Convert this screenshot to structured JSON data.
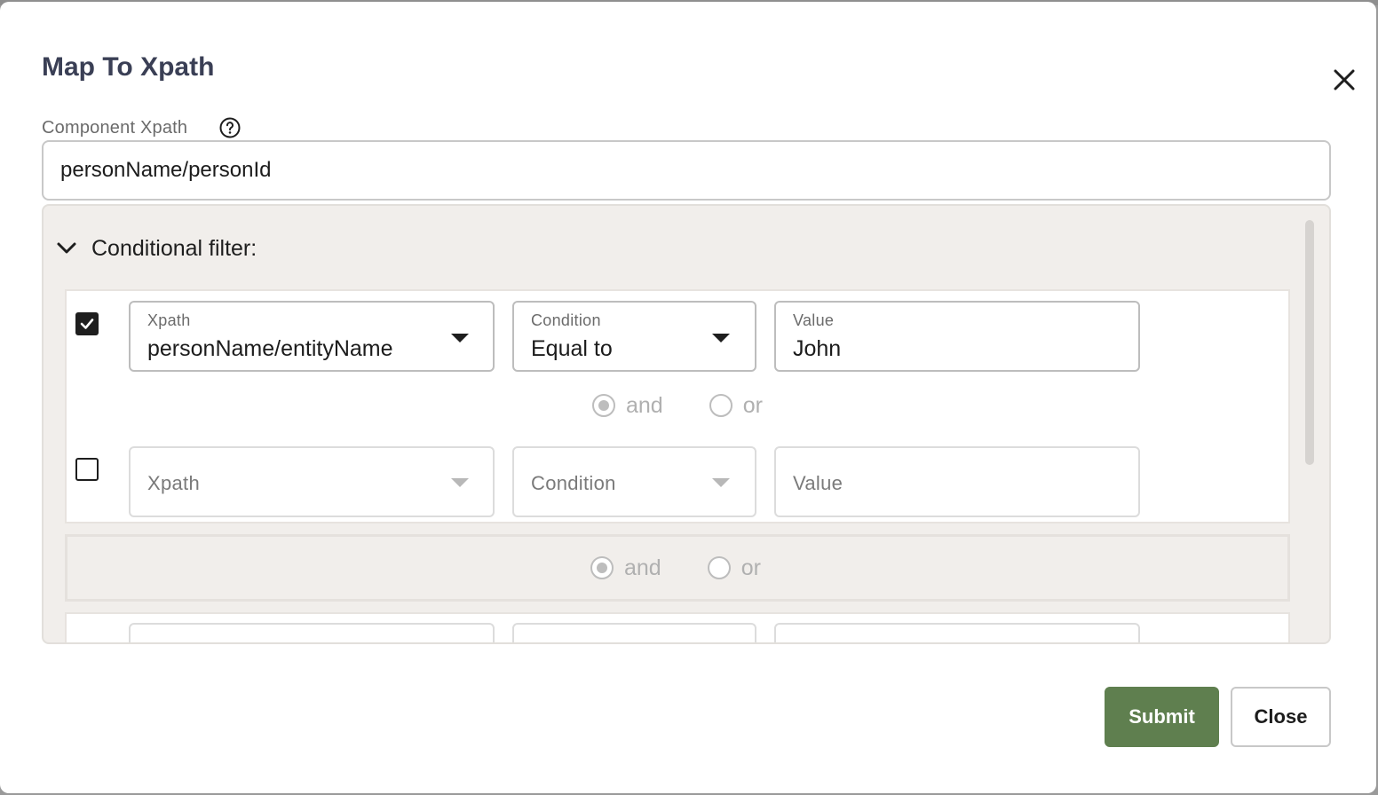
{
  "dialog": {
    "title": "Map To Xpath",
    "close_icon": "close-icon"
  },
  "component_xpath": {
    "label": "Component Xpath",
    "help_icon": "help-circle-icon",
    "value": "personName/personId"
  },
  "conditional_filter": {
    "header": "Conditional filter:",
    "toggle_icon": "chevron-down-icon",
    "rules": [
      {
        "checked": true,
        "xpath": {
          "label": "Xpath",
          "value": "personName/entityName"
        },
        "condition": {
          "label": "Condition",
          "value": "Equal to"
        },
        "value": {
          "label": "Value",
          "value": "John"
        }
      },
      {
        "checked": false,
        "xpath": {
          "placeholder": "Xpath"
        },
        "condition": {
          "placeholder": "Condition"
        },
        "value": {
          "placeholder": "Value"
        }
      }
    ],
    "inner_logic": {
      "and_label": "and",
      "or_label": "or",
      "selected": "and"
    },
    "group_logic": {
      "and_label": "and",
      "or_label": "or",
      "selected": "and"
    }
  },
  "footer": {
    "submit_label": "Submit",
    "close_label": "Close"
  },
  "colors": {
    "primary_button": "#5f7f4f",
    "title": "#3a3f55",
    "panel_bg": "#f1eeeb"
  }
}
